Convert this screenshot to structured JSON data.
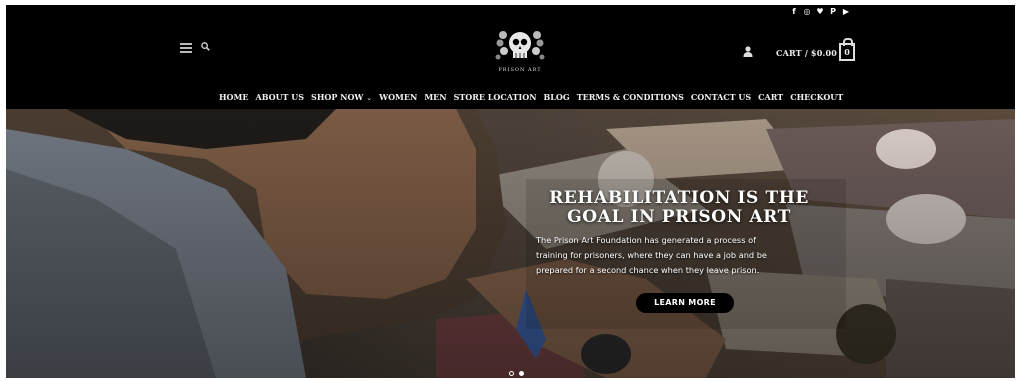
{
  "topbar": {
    "social_icons": [
      "facebook-icon",
      "instagram-icon",
      "twitter-icon",
      "pinterest-icon",
      "youtube-icon"
    ],
    "social_glyphs": [
      "f",
      "◎",
      "♥",
      "P",
      "▶"
    ]
  },
  "header": {
    "logo_text": "PRISON ART",
    "cart_label": "CART / $0.00",
    "cart_count": "0"
  },
  "nav": {
    "items": [
      "HOME",
      "ABOUT US",
      "SHOP NOW",
      "WOMEN",
      "MEN",
      "STORE LOCATION",
      "BLOG",
      "TERMS & CONDITIONS",
      "CONTACT US",
      "CART",
      "CHECKOUT"
    ],
    "dropdown_suffix": "⌄"
  },
  "hero": {
    "title_line1": "REHABILITATION IS THE",
    "title_line2": "GOAL IN PRISON ART",
    "body_line1": "The Prison Art Foundation has generated a process of",
    "body_line2": "training for prisoners, where they can have a job and be",
    "body_line3": "prepared for a second chance when they leave prison.",
    "cta_label": "LEARN MORE",
    "slide_count": 2,
    "active_slide": 2
  },
  "colors": {
    "background": "#000000",
    "text": "#ffffff",
    "hero_dark": "#3c342c"
  }
}
